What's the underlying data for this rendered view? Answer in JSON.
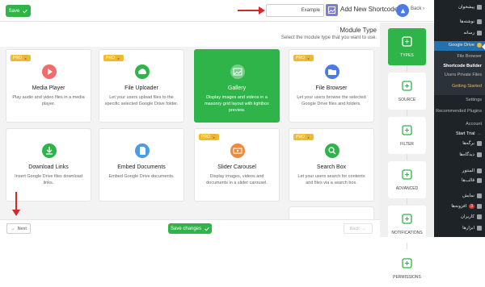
{
  "topbar": {
    "save_label": "Save",
    "title_input_value": "Example",
    "page_title": "Add New Shortcode",
    "back_label": "Back"
  },
  "module": {
    "title": "Module Type",
    "description": "Select the module type that you want to use."
  },
  "cards": [
    {
      "title": "Media Player",
      "desc": "Play audio and video files in a media player.",
      "pro": true,
      "active": false,
      "icon": "play-icon",
      "color": "#f26b6b"
    },
    {
      "title": "File Uploader",
      "desc": "Let your users upload files to the specific selected Google Drive folder.",
      "pro": true,
      "active": false,
      "icon": "cloud-upload-icon",
      "color": "#2fb44a"
    },
    {
      "title": "Gallery",
      "desc": "Display images and videos in a masonry grid layout with lightbox preview.",
      "pro": false,
      "active": true,
      "icon": "image-icon",
      "color": "#7a7ddb"
    },
    {
      "title": "File Browser",
      "desc": "Let your users browse the selected Google Drive files and folders.",
      "pro": true,
      "active": false,
      "icon": "folder-icon",
      "color": "#4c7be5"
    },
    {
      "title": "Download Links",
      "desc": "Insert Google Drive files download links.",
      "pro": false,
      "active": false,
      "icon": "download-icon",
      "color": "#2fb44a"
    },
    {
      "title": "Embed Documents",
      "desc": "Embed Google Drive documents.",
      "pro": false,
      "active": false,
      "icon": "document-icon",
      "color": "#4c9be5"
    },
    {
      "title": "Slider Carousel",
      "desc": "Display images, videos and documents in a slider carousel.",
      "pro": true,
      "active": false,
      "icon": "slider-icon",
      "color": "#f0893a"
    },
    {
      "title": "Search Box",
      "desc": "Let your users search for contents and files via a search box.",
      "pro": true,
      "active": false,
      "icon": "search-icon",
      "color": "#2fb44a"
    }
  ],
  "pro_label": "PRO",
  "footer": {
    "next_label": "Next",
    "save_changes_label": "Save changes",
    "back_label": "Back"
  },
  "steps": [
    {
      "label": "TYPES",
      "active": true
    },
    {
      "label": "SOURCE",
      "active": false
    },
    {
      "label": "FILTER",
      "active": false
    },
    {
      "label": "ADVANCED",
      "active": false
    },
    {
      "label": "NOTIFICATIONS",
      "active": false
    },
    {
      "label": "PERMISSIONS",
      "active": false
    }
  ],
  "wp_menu": {
    "dashboard": "پیشخوان",
    "posts": "نوشته‌ها",
    "media": "رسانه",
    "google_drive": "Google Drive",
    "file_browser": "File Browser",
    "shortcode_builder": "Shortcode Builder",
    "users_private_files": "Users Private Files",
    "getting_started": "Getting Started",
    "settings": "Settings",
    "recommended_plugins": "Recommended Plugins",
    "account": "Account",
    "start_trial": "Start Trial",
    "pages": "برگه‌ها",
    "comments": "دیدگاه‌ها",
    "appearance": "نمایش",
    "plugins": "افزونه‌ها",
    "plugins_badge": "3",
    "users": "کاربران",
    "tools": "ابزارها",
    "elementor": "المنتور",
    "templates": "قالب‌ها"
  },
  "colors": {
    "accent": "#2fb44a",
    "pro": "#f0b92f",
    "wp_sidebar": "#1d2327",
    "wp_active": "#2271b1",
    "red_arrow": "#d62828"
  }
}
